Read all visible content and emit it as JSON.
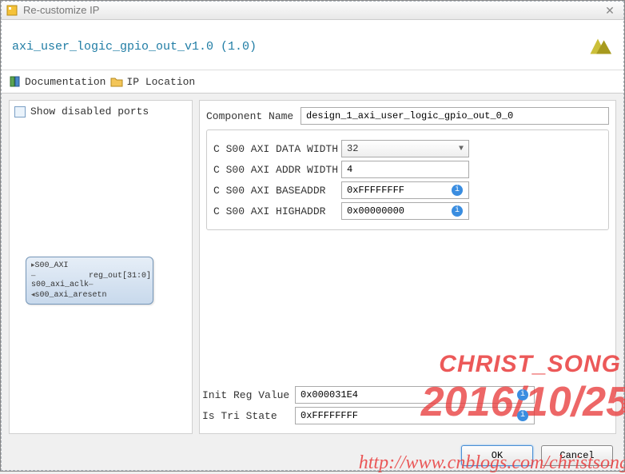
{
  "window": {
    "title": "Re-customize IP"
  },
  "header": {
    "ip_title": "axi_user_logic_gpio_out_v1.0 (1.0)"
  },
  "toolbar": {
    "documentation": "Documentation",
    "ip_location": "IP Location"
  },
  "left": {
    "show_disabled_ports": "Show disabled ports",
    "block": {
      "p1": "S00_AXI",
      "p2": "s00_axi_aclk",
      "p3": "s00_axi_aresetn",
      "out": "reg_out[31:0]"
    }
  },
  "fields": {
    "component_name_label": "Component Name",
    "component_name": "design_1_axi_user_logic_gpio_out_0_0",
    "data_width_label": "C S00 AXI DATA WIDTH",
    "data_width": "32",
    "addr_width_label": "C S00 AXI ADDR WIDTH",
    "addr_width": "4",
    "baseaddr_label": "C S00 AXI BASEADDR",
    "baseaddr": "0xFFFFFFFF",
    "highaddr_label": "C S00 AXI HIGHADDR",
    "highaddr": "0x00000000",
    "init_reg_label": "Init Reg Value",
    "init_reg": "0x000031E4",
    "tristate_label": "Is Tri State",
    "tristate": "0xFFFFFFFF"
  },
  "buttons": {
    "ok": "OK",
    "cancel": "Cancel"
  },
  "watermark": {
    "name": "CHRIST_SONG",
    "date": "2016/10/25",
    "url": "http://www.cnblogs.com/christsong"
  }
}
